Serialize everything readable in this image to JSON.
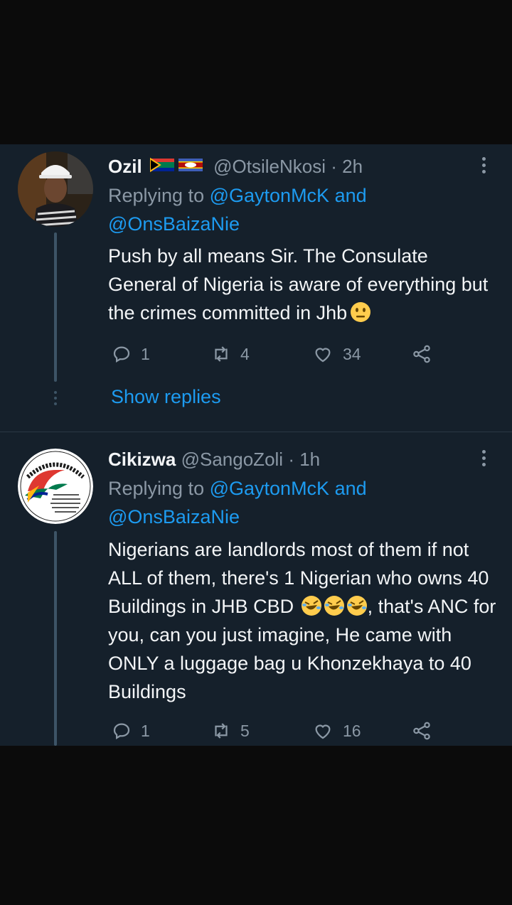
{
  "tweets": [
    {
      "name": "Ozil",
      "handle": "@OtsileNkosi",
      "time": "· 2h",
      "replying_prefix": "Replying to",
      "replying_user1": "@GaytonMcK",
      "replying_and": "and",
      "replying_user2": "@OnsBaizaNie",
      "text": "Push by all means Sir. The Consulate General of Nigeria is aware of everything but the crimes committed in Jhb",
      "emoji": "neutral-face",
      "replies": "1",
      "retweets": "4",
      "likes": "34",
      "show_replies": "Show replies"
    },
    {
      "name": "Cikizwa",
      "handle": "@SangoZoli",
      "time": "· 1h",
      "replying_prefix": "Replying to",
      "replying_user1": "@GaytonMcK",
      "replying_and": "and",
      "replying_user2": "@OnsBaizaNie",
      "text": "Nigerians are landlords most of them if not ALL of them, there's 1 Nigerian who owns 40 Buildings in JHB CBD",
      "emoji": "rolling-on-floor-laughing x3",
      "text_after": ", that's ANC for you, can you just imagine, He came with ONLY a luggage bag u Khonzekhaya to 40 Buildings",
      "replies": "1",
      "retweets": "5",
      "likes": "16",
      "avatar_logo_text": "PUT SOUTH AFRICANS FIRST"
    }
  ],
  "colors": {
    "background": "#15202b",
    "link": "#1d9bf0",
    "muted": "#8b98a5",
    "text": "#f3f5f7"
  }
}
